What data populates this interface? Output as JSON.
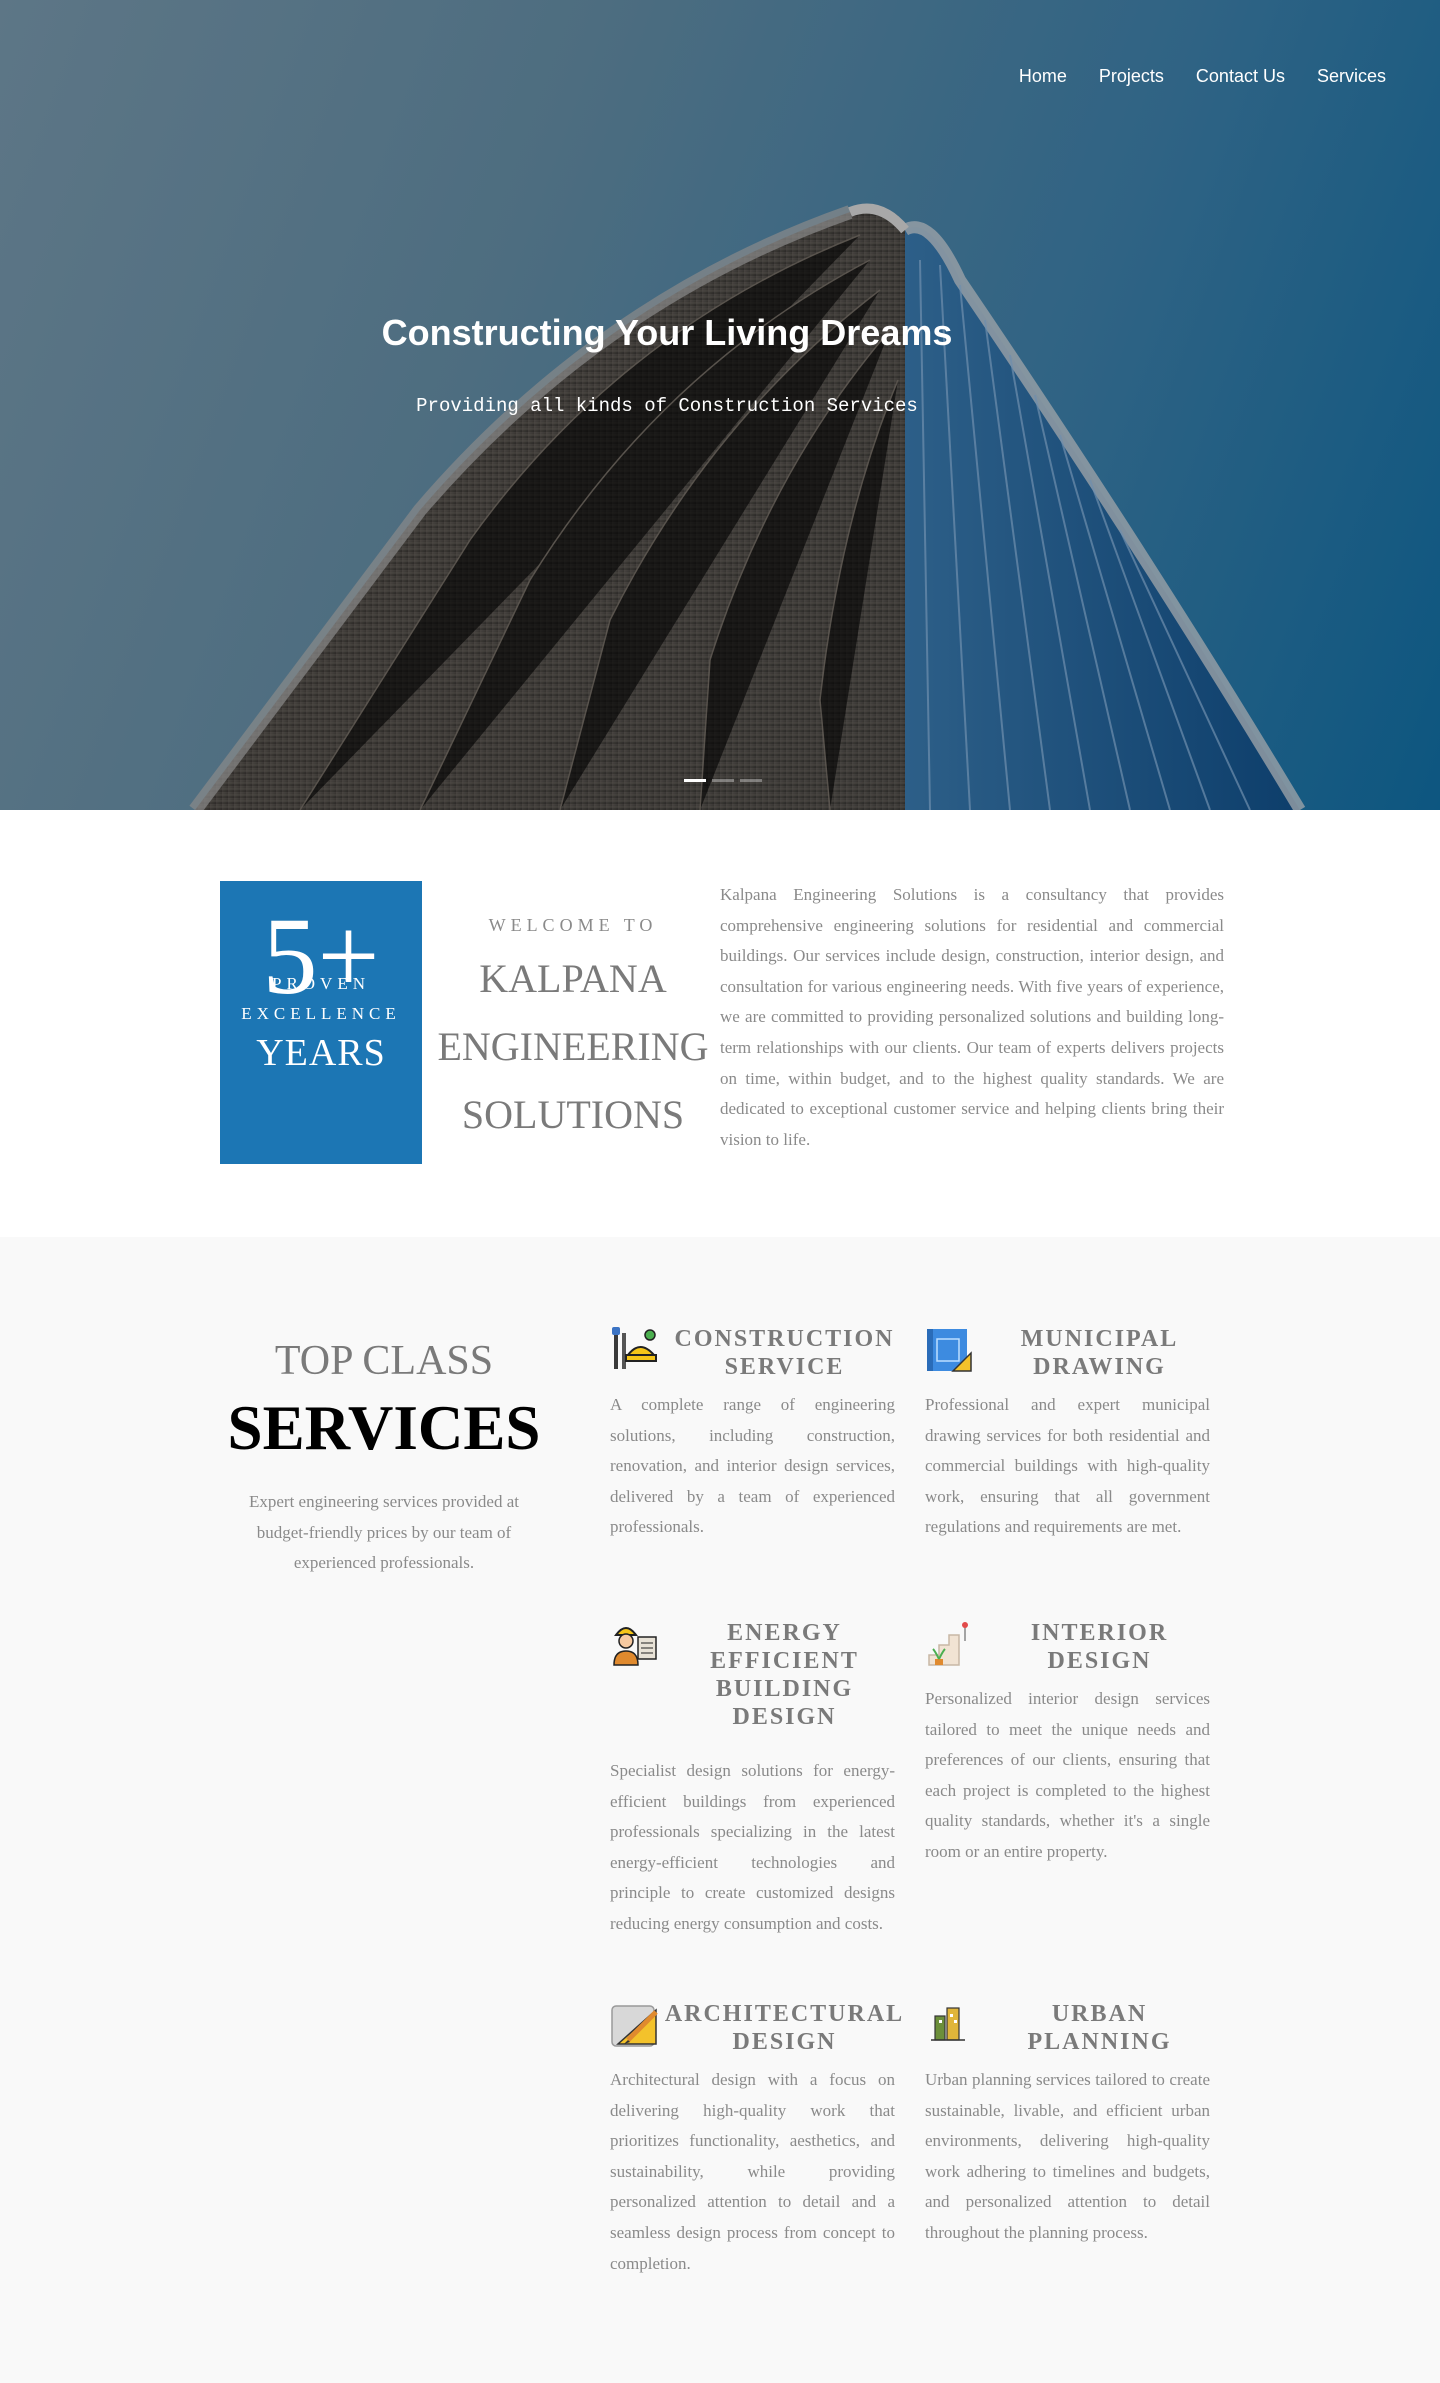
{
  "nav": {
    "items": [
      "Home",
      "Projects",
      "Contact Us",
      "Services"
    ]
  },
  "hero": {
    "title": "Constructing Your Living Dreams",
    "subtitle": "Providing all kinds of Construction Services",
    "slide_count": 3,
    "active_slide": 1
  },
  "about": {
    "years_number": "5+",
    "years_word": "YEARS",
    "years_tag_line1": "PROVEN",
    "years_tag_line2": "EXCELLENCE",
    "welcome": "WELCOME TO",
    "company_line1": "KALPANA",
    "company_line2": "ENGINEERING",
    "company_line3": "SOLUTIONS",
    "description": "Kalpana Engineering Solutions is a consultancy that provides comprehensive engineering solutions for residential and commercial buildings. Our services include design, construction, interior design, and consultation for various engineering needs. With five years of experience, we are committed to providing personalized solutions and building long-term relationships with our clients. Our team of experts delivers projects on time, within budget, and to the highest quality standards. We are dedicated to exceptional customer service and helping clients bring their vision to life.",
    "accent_color": "#1c76b4"
  },
  "services": {
    "top_class": "TOP CLASS",
    "heading": "SERVICES",
    "description": "Expert engineering services provided at budget-friendly prices by our team of experienced professionals.",
    "items": [
      {
        "icon": "construction-tools-icon",
        "title_l1": "CONSTRUCTION",
        "title_l2": "SERVICE",
        "title_l3": "",
        "title_l4": "",
        "description": "A complete range of engineering solutions, including construction, renovation, and interior design services, delivered by a team of experienced professionals."
      },
      {
        "icon": "blueprint-icon",
        "title_l1": "MUNICIPAL",
        "title_l2": "DRAWING",
        "title_l3": "",
        "title_l4": "",
        "description": "Professional and expert municipal drawing services for both residential and commercial buildings with high-quality work, ensuring that all government regulations and requirements are met."
      },
      {
        "icon": "engineer-icon",
        "title_l1": "ENERGY",
        "title_l2": "EFFICIENT",
        "title_l3": "BUILDING",
        "title_l4": "DESIGN",
        "description": "Specialist design solutions for energy-efficient buildings from experienced professionals specializing in the latest energy-efficient technologies and principle to create customized designs reducing energy consumption and costs."
      },
      {
        "icon": "interior-stairs-icon",
        "title_l1": "INTERIOR",
        "title_l2": "DESIGN",
        "title_l3": "",
        "title_l4": "",
        "description": "Personalized interior design services tailored to meet the unique needs and preferences of our clients, ensuring that each project is completed to the highest quality standards, whether it's a single room or an entire property."
      },
      {
        "icon": "ruler-pencil-icon",
        "title_l1": "ARCHITECTURAL",
        "title_l2": "DESIGN",
        "title_l3": "",
        "title_l4": "",
        "description": "Architectural design with a focus on delivering high-quality work that prioritizes functionality, aesthetics, and sustainability, while providing personalized attention to detail and a seamless design process from concept to completion."
      },
      {
        "icon": "city-buildings-icon",
        "title_l1": "URBAN",
        "title_l2": "PLANNING",
        "title_l3": "",
        "title_l4": "",
        "description": "Urban planning services tailored to create sustainable, livable, and efficient urban environments, delivering high-quality work adhering to timelines and budgets, and personalized attention to detail throughout the planning process."
      }
    ]
  }
}
